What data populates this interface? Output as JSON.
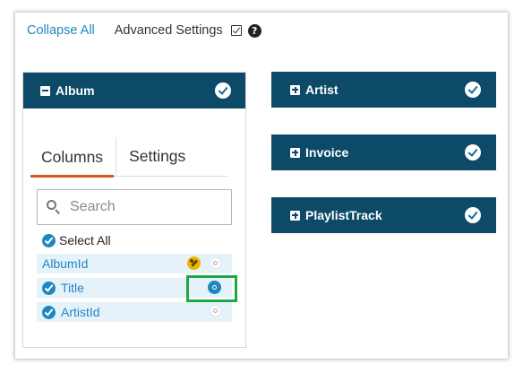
{
  "toolbar": {
    "collapse_all": "Collapse All",
    "advanced_settings": "Advanced Settings",
    "advanced_checked": true,
    "help_icon": "question-circle-icon"
  },
  "album": {
    "name": "Album",
    "expanded": true,
    "tabs": [
      {
        "label": "Columns",
        "active": true
      },
      {
        "label": "Settings",
        "active": false
      }
    ],
    "search_placeholder": "Search",
    "select_all_label": "Select All",
    "columns": [
      {
        "label": "AlbumId",
        "checked": false,
        "primary_key": true,
        "search_active": false
      },
      {
        "label": "Title",
        "checked": true,
        "primary_key": false,
        "search_active": true
      },
      {
        "label": "ArtistId",
        "checked": true,
        "primary_key": false,
        "search_active": false
      }
    ]
  },
  "tables": [
    {
      "name": "Artist",
      "expanded": false
    },
    {
      "name": "Invoice",
      "expanded": false
    },
    {
      "name": "PlaylistTrack",
      "expanded": false
    }
  ],
  "colors": {
    "header_bg": "#0d4a67",
    "link": "#1e87c0",
    "tab_active": "#e0521c",
    "row_bg": "#e6f2f9",
    "highlight": "#22a843",
    "key": "#f0b400"
  }
}
